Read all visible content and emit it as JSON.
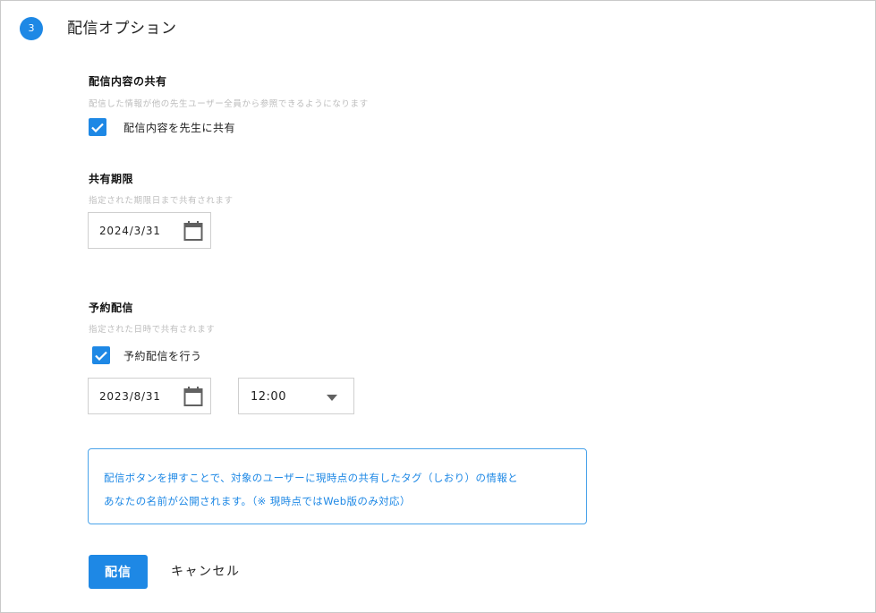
{
  "step": {
    "number": "3",
    "title": "配信オプション"
  },
  "share": {
    "title": "配信内容の共有",
    "description": "配信した情報が他の先生ユーザー全員から参照できるようになります",
    "checkbox_label": "配信内容を先生に共有",
    "checked": true
  },
  "period": {
    "title": "共有期限",
    "description": "指定された期限日まで共有されます",
    "date_value": "2024/3/31",
    "date_icon": "calendar-icon"
  },
  "schedule": {
    "title": "予約配信",
    "description": "指定された日時で共有されます",
    "checkbox_label": "予約配信を行う",
    "checked": true,
    "date_value": "2023/8/31",
    "date_icon": "calendar-icon",
    "time_value": "12:00",
    "time_icon": "caret-down-icon"
  },
  "notice": {
    "line1": "配信ボタンを押すことで、対象のユーザーに現時点の共有したタグ（しおり）の情報と",
    "line2": "あなたの名前が公開されます。（※ 現時点ではWeb版のみ対応）"
  },
  "actions": {
    "submit_label": "配信",
    "cancel_label": "キャンセル"
  },
  "colors": {
    "accent": "#1e88e5",
    "border": "#cfcfcf",
    "muted": "#bdbdbd"
  }
}
